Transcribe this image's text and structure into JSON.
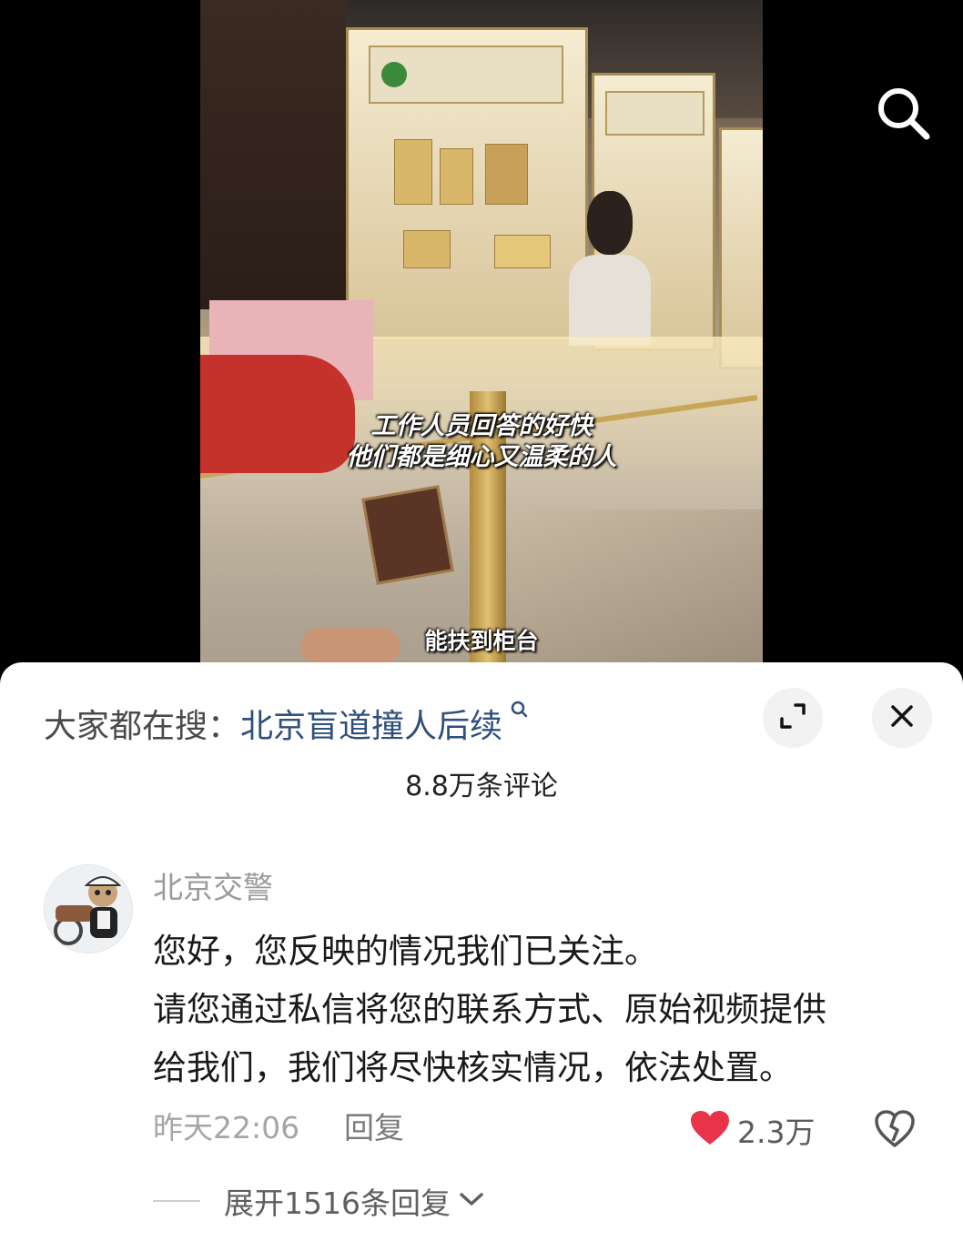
{
  "video": {
    "caption_line1": "工作人员回答的好快",
    "caption_line2": "他们都是细心又温柔的人",
    "caption_bottom": "能扶到柜台",
    "search_icon": "search-icon"
  },
  "hot_search": {
    "prefix": "大家都在搜：",
    "query": "北京盲道撞人后续",
    "query_icon": "search-icon",
    "expand_icon": "expand-icon",
    "close_icon": "close-icon"
  },
  "comments_header": {
    "count_label": "8.8万条评论"
  },
  "comment": {
    "author": "北京交警",
    "lines": [
      "您好，您反映的情况我们已关注。",
      "请您通过私信将您的联系方式、原始视频提供",
      "给我们，我们将尽快核实情况，依法处置。"
    ],
    "timestamp": "昨天22:06",
    "reply_label": "回复",
    "like_count": "2.3万",
    "like_icon": "heart-icon",
    "dislike_icon": "broken-heart-icon",
    "like_color": "#e8334a",
    "expand_replies_label": "展开1516条回复",
    "expand_icon": "chevron-down-icon"
  }
}
